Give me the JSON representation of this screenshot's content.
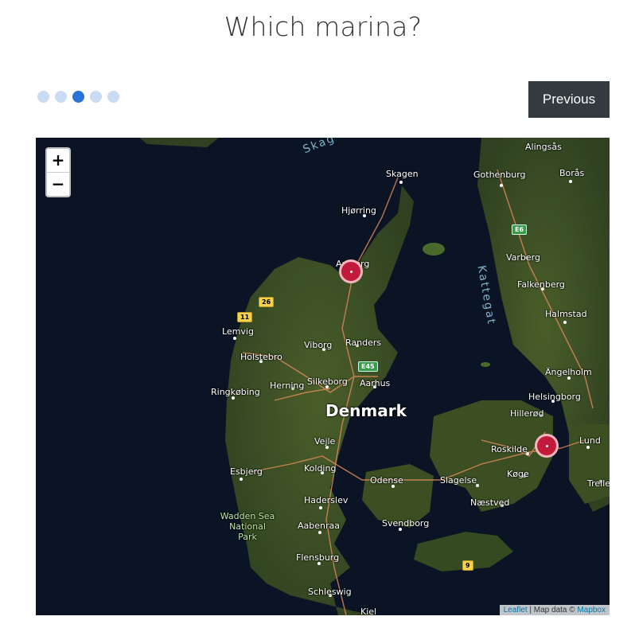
{
  "page": {
    "title": "Which marina?"
  },
  "progress": {
    "total_steps": 5,
    "current_step": 3
  },
  "nav": {
    "previous_label": "Previous"
  },
  "map": {
    "zoom_in_label": "+",
    "zoom_out_label": "−",
    "attribution": {
      "leaflet": "Leaflet",
      "separator": " | Map data © ",
      "mapbox": "Mapbox"
    },
    "country_label": "Denmark",
    "water_labels": {
      "skagerrak": "Skag",
      "kattegat": "Kattegat"
    },
    "park_label": "Wadden Sea National Park",
    "road_shields": [
      "26",
      "11",
      "E45",
      "E6",
      "9"
    ],
    "places": {
      "alingsas": "Alingsås",
      "gothenburg": "Gothenburg",
      "boras": "Borås",
      "skagen": "Skagen",
      "hjorring": "Hjørring",
      "aalborg": "Aalborg",
      "varberg": "Varberg",
      "falkenberg": "Falkenberg",
      "halmstad": "Halmstad",
      "lemvig": "Lemvig",
      "holstebro": "Holstebro",
      "viborg": "Viborg",
      "randers": "Randers",
      "angelholm": "Ängelholm",
      "ringkobing": "Ringkøbing",
      "herning": "Herning",
      "silkeborg": "Silkeborg",
      "aarhus": "Aarhus",
      "helsingborg": "Helsingborg",
      "hillerod": "Hillerød",
      "vejle": "Vejle",
      "roskilde": "Roskilde",
      "lund": "Lund",
      "esbjerg": "Esbjerg",
      "kolding": "Kolding",
      "odense": "Odense",
      "slagelse": "Slagelse",
      "koge": "Køge",
      "trelleborg": "Trelleborg",
      "haderslev": "Haderslev",
      "naestved": "Næstved",
      "aabenraa": "Aabenraa",
      "svendborg": "Svendborg",
      "flensburg": "Flensburg",
      "schleswig": "Schleswig",
      "kiel": "Kiel"
    },
    "markers": [
      {
        "name": "marker-aalborg"
      },
      {
        "name": "marker-copenhagen"
      }
    ],
    "colors": {
      "sea": "#0b1425",
      "land": "#3b4f23",
      "roads": "#d98a5a"
    }
  }
}
